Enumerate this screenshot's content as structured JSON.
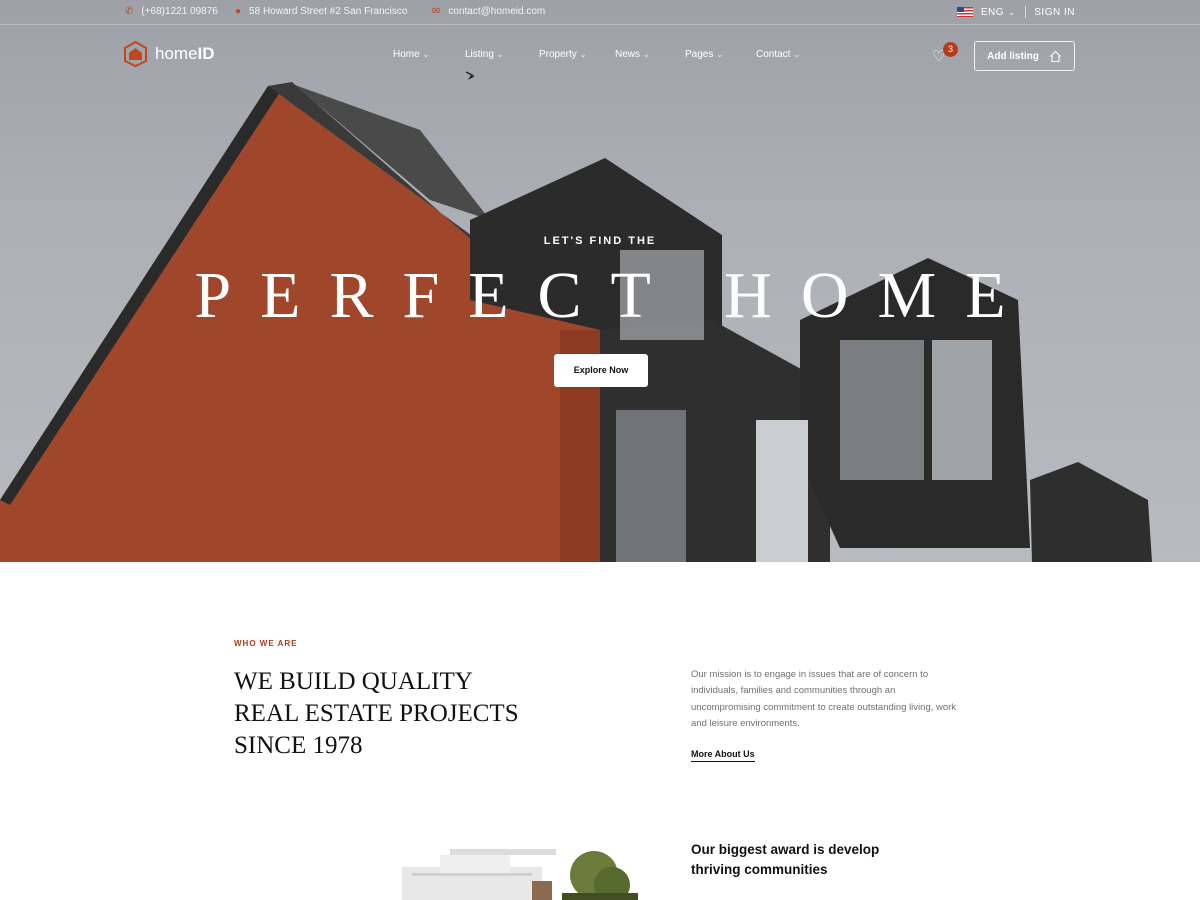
{
  "topbar": {
    "phone": "(+68)1221 09876",
    "address": "58 Howard Street #2 San Francisco",
    "email": "contact@homeid.com",
    "language": "ENG",
    "sign_in": "SIGN IN"
  },
  "brand": {
    "name_light": "home",
    "name_bold": "ID"
  },
  "nav": {
    "items": [
      {
        "label": "Home"
      },
      {
        "label": "Listing"
      },
      {
        "label": "Property"
      },
      {
        "label": "News"
      },
      {
        "label": "Pages"
      },
      {
        "label": "Contact"
      }
    ],
    "wishlist_count": "3",
    "add_listing": "Add listing"
  },
  "hero": {
    "subtitle": "LET'S FIND THE",
    "title": "PERFECT HOME",
    "cta": "Explore Now"
  },
  "about": {
    "eyebrow": "WHO WE ARE",
    "heading_lines": [
      "WE BUILD QUALITY",
      "REAL ESTATE PROJECTS",
      "SINCE 1978"
    ],
    "mission": "Our mission is to engage in issues that are of concern to individuals, families and communities through an uncompromising commitment to create outstanding living, work and leisure environments.",
    "more_link": "More About Us",
    "award": "Our biggest award is develop thriving communities"
  },
  "colors": {
    "accent": "#b83a1a",
    "text": "#111111",
    "muted": "#6f6f6f"
  },
  "icons": [
    "phone-icon",
    "location-pin-icon",
    "mail-icon",
    "us-flag-icon",
    "chevron-down-icon",
    "heart-icon",
    "house-icon",
    "logo-house-icon"
  ]
}
